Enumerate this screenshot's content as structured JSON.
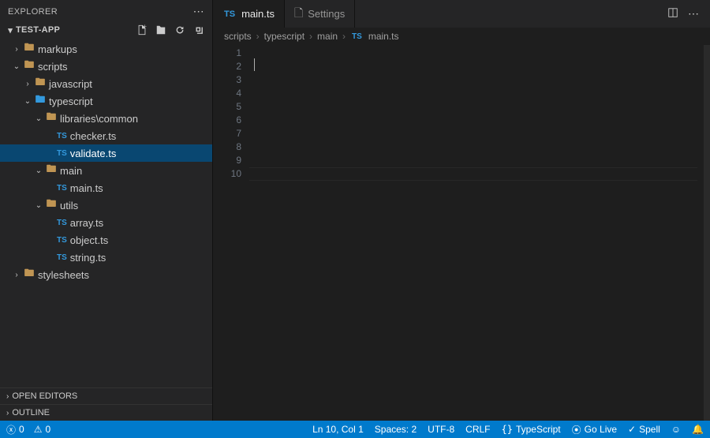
{
  "sidebar": {
    "title": "EXPLORER",
    "project": "TEST-APP",
    "sections": {
      "open_editors": "OPEN EDITORS",
      "outline": "OUTLINE"
    }
  },
  "tree": {
    "markups": "markups",
    "scripts": "scripts",
    "javascript": "javascript",
    "typescript": "typescript",
    "libraries_common": "libraries\\common",
    "checker": "checker.ts",
    "validate": "validate.ts",
    "main_folder": "main",
    "main_ts": "main.ts",
    "utils": "utils",
    "array": "array.ts",
    "object": "object.ts",
    "string": "string.ts",
    "stylesheets": "stylesheets"
  },
  "tabs": {
    "main": "main.ts",
    "settings": "Settings"
  },
  "breadcrumb": {
    "p0": "scripts",
    "p1": "typescript",
    "p2": "main",
    "p3": "main.ts"
  },
  "editor": {
    "line_count": 10
  },
  "status": {
    "errors": "0",
    "warnings": "0",
    "ln_col": "Ln 10, Col 1",
    "spaces": "Spaces: 2",
    "encoding": "UTF-8",
    "eol": "CRLF",
    "language": "TypeScript",
    "golive": "Go Live",
    "spell": "Spell"
  },
  "icons": {
    "ts": "TS",
    "sep": "›"
  }
}
